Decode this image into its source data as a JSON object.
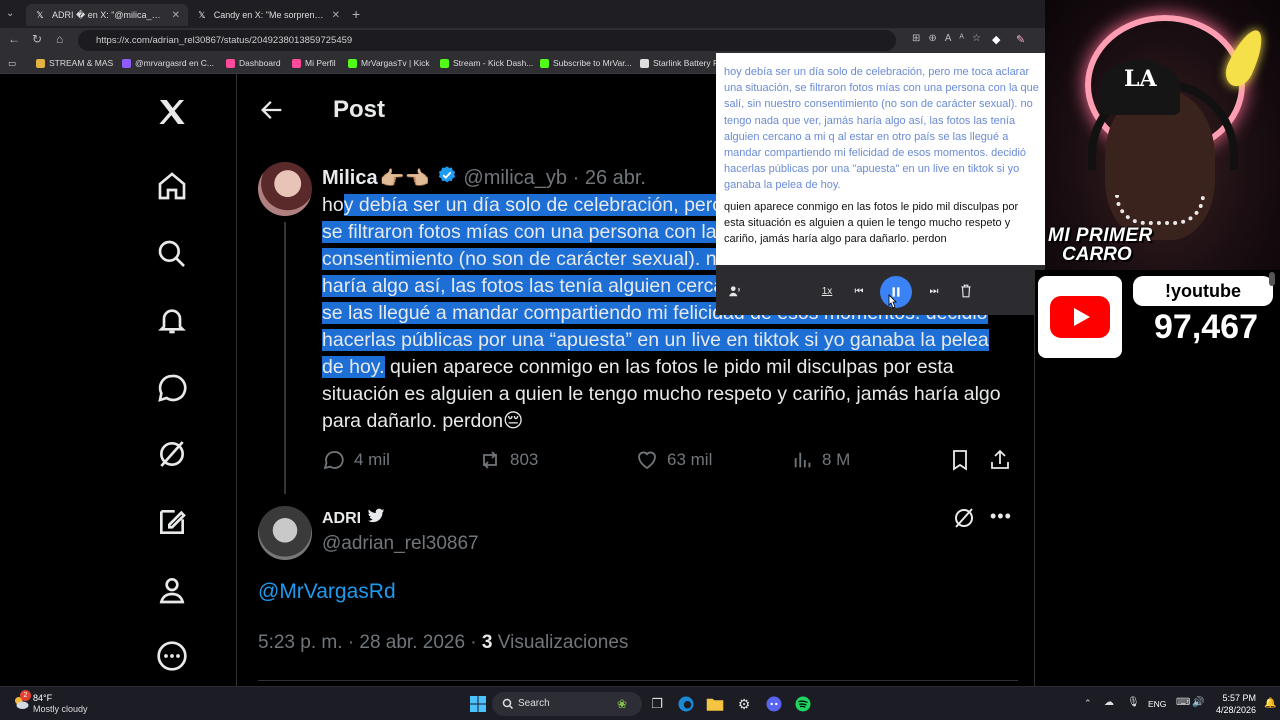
{
  "browser": {
    "tabs": [
      {
        "label": "ADRI � en X: \"@milica_yb @MrVar...",
        "active": true
      },
      {
        "label": "Candy en X: \"Me sorprendió la re...",
        "active": false
      }
    ],
    "url": "https://x.com/adrian_rel30867/status/2049238013859725459",
    "bookmarks": [
      "STREAM & MAS",
      "@mrvargasrd en C...",
      "Dashboard",
      "Mi Perfil",
      "MrVargasTv | Kick",
      "Stream - Kick Dash...",
      "Subscribe to MrVar...",
      "Starlink Battery F..."
    ]
  },
  "x": {
    "page_title": "Post",
    "tweet": {
      "author_name": "Milica",
      "author_emoji": "👉🏼👈🏼",
      "handle_date": "@milica_yb · 26 abr.",
      "text_prefix": "ho",
      "text_selected": "y debía ser un día solo de celebración, pero me toca aclarar una situación, se filtraron fotos mías con una persona con la que salí, sin nuestro consentimiento (no son de carácter sexual). no tengo nada que ver, jamás haría algo así, las fotos las tenía alguien cercano a mi q al estar en otro país se las llegué a mandar compartiendo mi felicidad de esos momentos.  decidió hacerlas públicas por una “apuesta” en un live en tiktok si yo ganaba la pelea de hoy.",
      "text_rest": " quien aparece conmigo en las fotos le pido mil disculpas por esta situación es alguien a quien le tengo mucho respeto y cariño,  jamás haría algo para dañarlo. perdon😔",
      "replies": "4 mil",
      "reposts": "803",
      "likes": "63 mil",
      "views": "8 M"
    },
    "reply": {
      "author_name": "ADRI",
      "handle": "@adrian_rel30867",
      "mention": "@MrVargasRd",
      "time": "5:23 p. m. · 28 abr. 2026 · ",
      "views_count": "3",
      "views_label": " Visualizaciones"
    }
  },
  "reader": {
    "read_text": "hoy debía ser un día solo de celebración, pero me toca aclarar una situación, se filtraron fotos mías con una persona con la que salí, sin nuestro consentimiento (no son de carácter sexual). no tengo nada que ver, jamás haría algo así, las fotos las tenía alguien cercano a mi q al estar en otro país se las llegué a mandar compartiendo mi felicidad de esos momentos. decidió hacerlas públicas por una \"apuesta\" en un live en tiktok si yo ganaba la pelea de hoy.",
    "current_text": "quien aparece conmigo en las fotos le pido mil disculpas por esta situación es alguien a quien le tengo mucho respeto y cariño, jamás haría algo para dañarlo. perdon",
    "speed": "1x"
  },
  "stream": {
    "overlay_line1": "MI PRIMER",
    "overlay_line2": "CARRO",
    "yt_command": "!youtube",
    "yt_count": "97,467"
  },
  "taskbar": {
    "temperature": "84°F",
    "weather": "Mostly cloudy",
    "search_placeholder": "Search",
    "lang": "ENG",
    "time": "5:57 PM",
    "date": "4/28/2026",
    "notification_badge": "2"
  },
  "colors": {
    "accent_blue": "#1d9bf0",
    "selection": "#1d6fd6",
    "youtube_red": "#ff0000"
  }
}
